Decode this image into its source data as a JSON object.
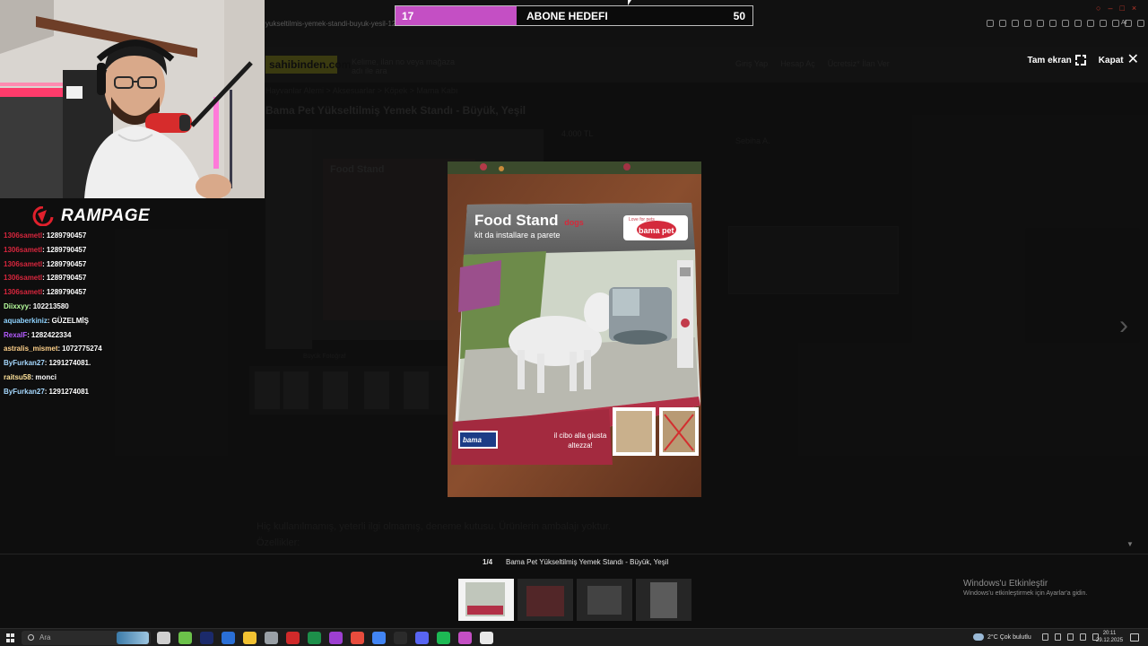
{
  "browser": {
    "url_fragment": "yukseltilmis-yemek-standi-buyuk-yesil-128979...",
    "ai_label": "AI"
  },
  "goal": {
    "current": "17",
    "label": "ABONE HEDEFI",
    "target": "50",
    "progress_fraction": 0.34,
    "fill_color": "#c44fc4"
  },
  "background_page": {
    "logo": "sahibinden.com",
    "search_placeholder": "Kelime, ilan no veya mağaza adı ile ara",
    "right_menu": [
      "Giriş Yap",
      "Hesap Aç",
      "Ücretsiz* İlan Ver"
    ],
    "breadcrumb": "Hayvanlar Alemi  >  Aksesuarlar  >  Köpek  >  Mama Kabı",
    "title": "Bama Pet Yükseltilmiş Yemek Standı - Büyük, Yeşil",
    "price": "4.000 TL",
    "photo_box_caption": "Food Stand",
    "big_photo_label": "Büyük Fotoğraf",
    "seller_name": "Sebiha A.",
    "description": "Hiç kullanılmamış, yeterli ilgi olmamış, deneme kutusu. Ürünlerin ambalajı yoktur. Özellikler:"
  },
  "lightbox": {
    "fullscreen_label": "Tam ekran",
    "close_label": "Kapat",
    "counter": "1/4",
    "caption": "Bama Pet Yükseltilmiş Yemek Standı - Büyük, Yeşil",
    "thumbnail_count": 4
  },
  "product_box": {
    "title": "Food Stand",
    "title_badge": "dogs",
    "subtitle": "kit da installare a parete",
    "brand": "bama pet",
    "brand_tag": "Love for pets",
    "bottom_text": "il cibo alla giusta altezza!",
    "bottom_brand": "bama"
  },
  "stream": {
    "brand": "RAMPAGE",
    "chat": [
      {
        "user": "1306sametl",
        "message": "1289790457",
        "color": "#d7263d"
      },
      {
        "user": "1306sametl",
        "message": "1289790457",
        "color": "#d7263d"
      },
      {
        "user": "1306sametl",
        "message": "1289790457",
        "color": "#d7263d"
      },
      {
        "user": "1306sametl",
        "message": "1289790457",
        "color": "#d7263d"
      },
      {
        "user": "1306sametl",
        "message": "1289790457",
        "color": "#d7263d"
      },
      {
        "user": "Diixxyy",
        "message": "102213580",
        "color": "#b8ff9e"
      },
      {
        "user": "aquaberkiniz",
        "message": "GÜZELMİŞ",
        "color": "#8fd3ff"
      },
      {
        "user": "RexaIF",
        "message": "1282422334",
        "color": "#b45cff"
      },
      {
        "user": "astralis_mismet",
        "message": "1072775274",
        "color": "#ffd18a"
      },
      {
        "user": "ByFurkan27",
        "message": "1291274081.",
        "color": "#a6d9ff"
      },
      {
        "user": "raitsu58",
        "message": "monci",
        "color": "#ffe39a"
      },
      {
        "user": "ByFurkan27",
        "message": "1291274081",
        "color": "#a6d9ff"
      }
    ]
  },
  "windows": {
    "activate_title": "Windows'u Etkinleştir",
    "activate_sub": "Windows'u etkinleştirmek için Ayarlar'a gidin."
  },
  "taskbar": {
    "search_placeholder": "Ara",
    "weather": "2°C  Çok bulutlu",
    "time": "20:11",
    "date": "29.12.2025",
    "app_colors": [
      "#cfcfcf",
      "#6cc24a",
      "#1b2a6b",
      "#2a6fd6",
      "#f2c232",
      "#9aa0a6",
      "#d02a2a",
      "#1d8f4a",
      "#9d3fd1",
      "#e84c3d",
      "#4285f4",
      "#2b2b2b",
      "#5865f2",
      "#1db954",
      "#c44fc4",
      "#e8e8e8"
    ]
  }
}
